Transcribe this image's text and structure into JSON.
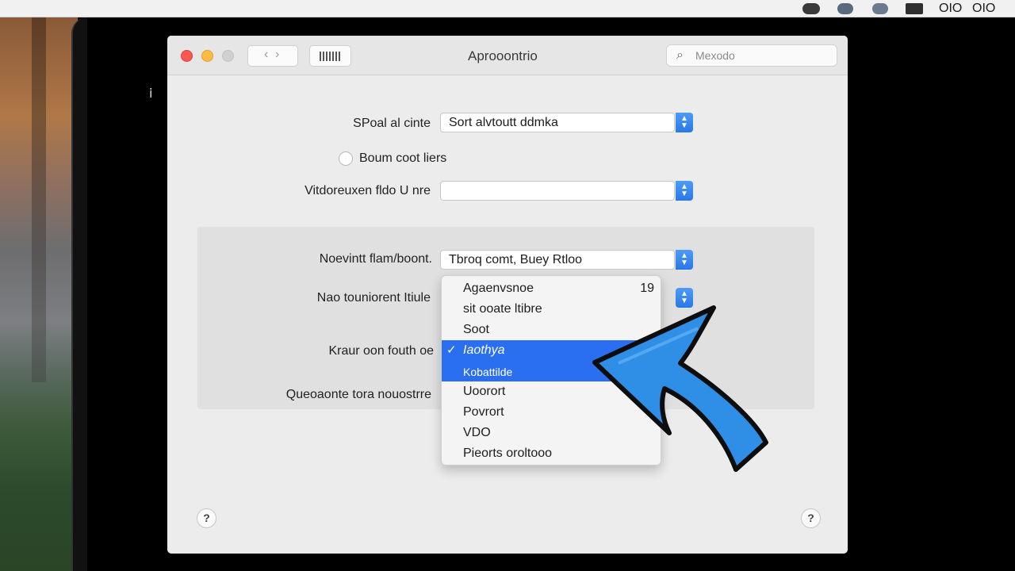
{
  "menubar": {
    "icons": [
      "menubar-status-icon",
      "wifi-icon",
      "bluetooth-icon",
      "battery-icon"
    ],
    "text_1": "OIO",
    "text_2": "OIO"
  },
  "stray_mark": "ⅰ",
  "window": {
    "title": "Aprooontrio",
    "search": {
      "placeholder": "Mexodo"
    }
  },
  "form": {
    "rows": [
      {
        "label": "SPoal al cinte",
        "value": "Sort alvtoutt ddmka"
      },
      {
        "label": "Boum coot liers",
        "type": "radio"
      },
      {
        "label": "Vitdoreuxen fldo U nre",
        "value": ""
      }
    ],
    "panel_rows": [
      {
        "label": "Noevintt flam/boont.",
        "value": "Tbroq comt, Buey Rtloo"
      },
      {
        "label": "Nao touniorent Itiule",
        "value": ""
      },
      {
        "label": "Kraur oon fouth oe",
        "value": ""
      },
      {
        "label": "Queoaonte tora nouostrre",
        "value": ""
      }
    ]
  },
  "dropdown": {
    "items": [
      {
        "label": "Agaenvsnoe",
        "shortcut": "19",
        "selected": false
      },
      {
        "label": "sit ooate ltibre",
        "shortcut": "",
        "selected": false
      },
      {
        "label": "Soot",
        "shortcut": "",
        "selected": false
      },
      {
        "label": "Iaothya",
        "shortcut": "",
        "selected": true,
        "checked": true
      },
      {
        "label": "Kobattilde",
        "shortcut": "",
        "selected": true,
        "checked": false
      },
      {
        "label": "Uoorort",
        "shortcut": "",
        "selected": false
      },
      {
        "label": "Povrort",
        "shortcut": "",
        "selected": false
      },
      {
        "label": "VDO",
        "shortcut": "",
        "selected": false
      },
      {
        "label": "Pieorts oroltooo",
        "shortcut": "",
        "selected": false
      }
    ]
  },
  "help": {
    "left": "?",
    "right": "?"
  },
  "colors": {
    "accent": "#2a6ff0",
    "stepper": "#3b8bf0",
    "arrow_fill": "#2f8ee6",
    "close": "#fc5753",
    "minimize": "#fdbc40"
  }
}
